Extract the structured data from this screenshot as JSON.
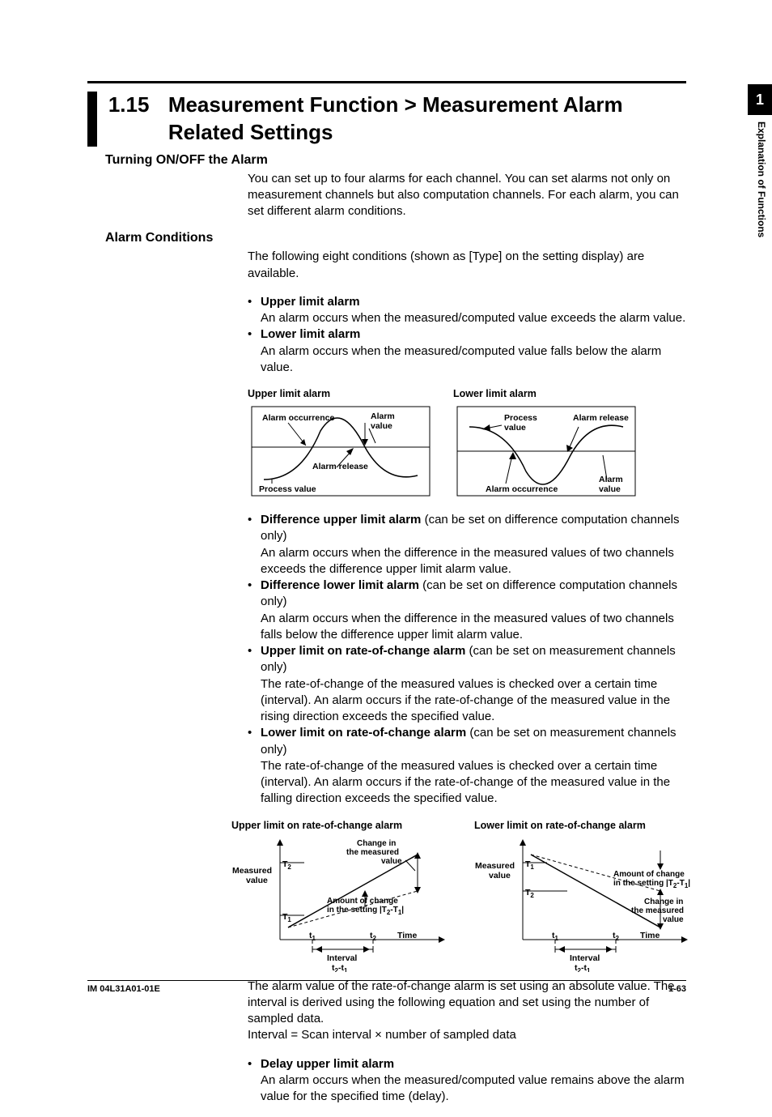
{
  "section": {
    "number": "1.15",
    "title": "Measurement Function > Measurement Alarm Related Settings"
  },
  "turning": {
    "heading": "Turning ON/OFF the Alarm",
    "body": "You can set up to four alarms for each channel.  You can set alarms not only on measurement channels but also computation channels.  For each alarm, you can set different alarm conditions."
  },
  "conditions": {
    "heading": "Alarm Conditions",
    "intro": "The following eight conditions (shown as [Type] on the setting display) are available.",
    "upper": {
      "name": "Upper limit alarm",
      "body": "An alarm occurs when the measured/computed value exceeds the alarm value."
    },
    "lower": {
      "name": "Lower limit alarm",
      "body": "An alarm occurs when the measured/computed value falls below the alarm value."
    },
    "fig1": {
      "leftTitle": "Upper limit alarm",
      "rightTitle": "Lower limit alarm",
      "labels": {
        "alarmOccurrence": "Alarm occurrence",
        "alarmValue": "Alarm value",
        "alarmRelease": "Alarm release",
        "processValue": "Process value"
      }
    },
    "diffUpper": {
      "name": "Difference upper limit alarm",
      "note": " (can be set on difference computation channels only)",
      "body": "An alarm occurs when the difference in the measured values of two channels exceeds the difference upper limit alarm value."
    },
    "diffLower": {
      "name": "Difference lower limit alarm",
      "note": " (can be set on difference computation channels only)",
      "body": "An alarm occurs when the difference in the measured values of two channels falls below the difference upper limit alarm value."
    },
    "rocUpper": {
      "name": "Upper limit on rate-of-change alarm",
      "note": " (can be set on measurement channels only)",
      "body": "The rate-of-change of the measured values is checked over a certain time (interval).  An alarm occurs if the rate-of-change of the measured value in the rising direction exceeds the specified value."
    },
    "rocLower": {
      "name": "Lower limit on rate-of-change alarm",
      "note": " (can be set on measurement channels only)",
      "body": "The rate-of-change of the measured values is checked over a certain time (interval).  An alarm occurs if the rate-of-change of the measured value in the falling direction exceeds the specified value."
    },
    "fig2": {
      "leftTitle": "Upper limit on rate-of-change alarm",
      "rightTitle": "Lower limit on rate-of-change alarm",
      "labels": {
        "measuredValue": "Measured value",
        "changeMeasured": "Change in the measured value",
        "amountChange1": "Amount of change",
        "amountChange2": "in the setting",
        "amountChangeExpr": "|T₂-T₁|",
        "T1": "T₁",
        "T2": "T₂",
        "t1": "t₁",
        "t2": "t₂",
        "time": "Time",
        "interval": "Interval",
        "intervalExpr": "t₂-t₁"
      }
    },
    "rocNote": "The alarm value of the rate-of-change alarm is set using an absolute value.  The interval is derived using the following equation and set using the number of sampled data.",
    "rocEq": "Interval = Scan interval × number of sampled data",
    "delayUpper": {
      "name": "Delay upper limit alarm",
      "body": "An alarm occurs when the measured/computed value remains above the alarm value for the specified time (delay)."
    }
  },
  "sideTab": "1",
  "sideText": "Explanation of Functions",
  "footer": {
    "left": "IM 04L31A01-01E",
    "right": "1-63"
  }
}
